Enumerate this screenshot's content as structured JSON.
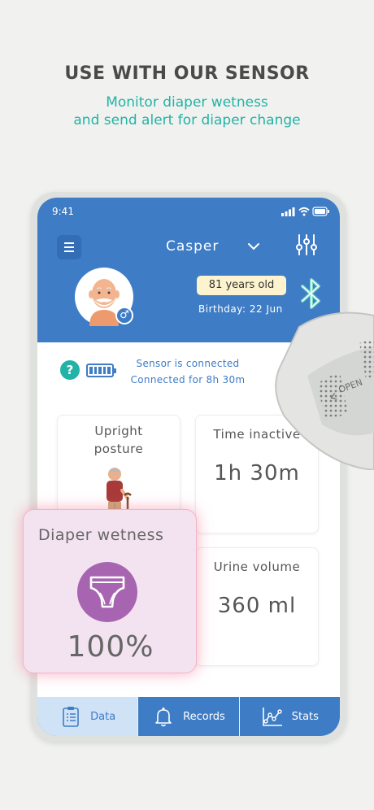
{
  "promo": {
    "headline": "USE WITH OUR SENSOR",
    "subline_1": "Monitor diaper wetness",
    "subline_2": "and send alert for diaper change"
  },
  "status_bar": {
    "time": "9:41"
  },
  "header": {
    "patient_name": "Casper",
    "age": "81 years old",
    "birthday": "Birthday: 22 Jun"
  },
  "sensor": {
    "status": "Sensor is connected",
    "duration": "Connected for 8h 30m",
    "battery_level": 1.0
  },
  "cards": {
    "posture": {
      "label_1": "Upright",
      "label_2": "posture"
    },
    "time_inactive": {
      "label": "Time inactive",
      "value": "1h 30m"
    },
    "urine_volume": {
      "label": "Urine volume",
      "value": "360 ml"
    },
    "diaper_wetness": {
      "label": "Diaper wetness",
      "value": "100%"
    }
  },
  "device": {
    "label": "OPEN"
  },
  "nav": {
    "items": [
      {
        "label": "Data",
        "icon": "clipboard-icon"
      },
      {
        "label": "Records",
        "icon": "bell-icon"
      },
      {
        "label": "Stats",
        "icon": "line-chart-icon"
      }
    ]
  },
  "colors": {
    "primary_blue": "#3f7cc6",
    "teal": "#22b3a6",
    "diaper_purple": "#a765b1",
    "wet_card_bg": "#f3e3f1",
    "age_badge_bg": "#fdf3cf"
  }
}
